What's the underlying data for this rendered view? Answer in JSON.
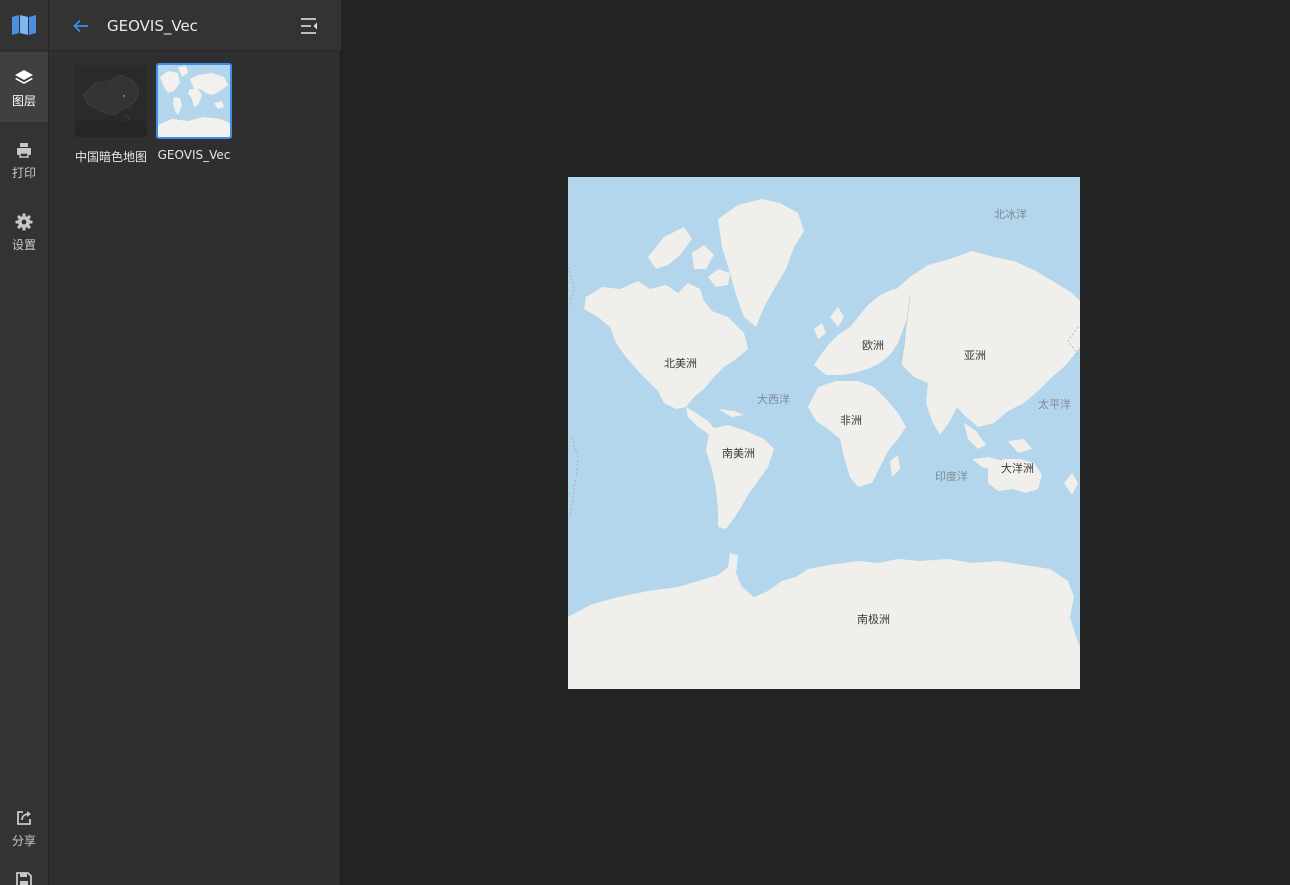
{
  "rail": {
    "items": [
      {
        "label": "图层",
        "icon": "layers-icon"
      },
      {
        "label": "打印",
        "icon": "printer-icon"
      },
      {
        "label": "设置",
        "icon": "gear-icon"
      },
      {
        "label": "分享",
        "icon": "share-icon"
      }
    ]
  },
  "panel": {
    "title": "GEOVIS_Vec",
    "basemaps": [
      {
        "label": "中国暗色地图",
        "selected": false
      },
      {
        "label": "GEOVIS_Vec",
        "selected": true
      }
    ]
  },
  "map": {
    "continents": [
      "北美洲",
      "欧洲",
      "亚洲",
      "非洲",
      "南美洲",
      "大洋洲",
      "南极洲"
    ],
    "oceans": [
      "北冰洋",
      "大西洋",
      "太平洋",
      "印度洋"
    ]
  },
  "colors": {
    "accent": "#3d8ee6",
    "ocean": "#b4d6ec",
    "land": "#f0efec"
  }
}
